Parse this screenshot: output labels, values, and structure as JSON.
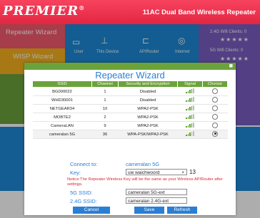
{
  "header": {
    "brand": "PREMIER",
    "brand_mark": "®",
    "model": "11AC Dual Band Wireless Repeater"
  },
  "tiles": {
    "repeater_wizard": "Repeater Wizard",
    "wisp_wizard": "WISP Wizard"
  },
  "topology": {
    "user": "User",
    "device": "This Device",
    "ap": "AP/Router",
    "internet": "Internet"
  },
  "status": {
    "clients_24": "2.4G Wifi Clients: 0",
    "clients_5": "5G Wifi Clients: 0",
    "stars": "★★★★★"
  },
  "modal": {
    "title": "Repeater Wizard",
    "columns": [
      "SSID",
      "Channel",
      "Security and Encryption",
      "Signal",
      "Choose"
    ],
    "rows": [
      {
        "ssid": "BG000022",
        "channel": "1",
        "security": "Disabled",
        "signal": 4,
        "selected": false
      },
      {
        "ssid": "WHD30001",
        "channel": "1",
        "security": "Disabled",
        "signal": 4,
        "selected": false
      },
      {
        "ssid": "NETGEAR34",
        "channel": "10",
        "security": "WPA2-PSK",
        "signal": 4,
        "selected": false
      },
      {
        "ssid": "MOBTE2",
        "channel": "2",
        "security": "WPA2-PSK",
        "signal": 4,
        "selected": false
      },
      {
        "ssid": "CameraLAN",
        "channel": "9",
        "security": "WPA2-PSK",
        "signal": 4,
        "selected": false
      },
      {
        "ssid": "cameralan 5G",
        "channel": "36",
        "security": "WPA-PSK/WPA2-PSK",
        "signal": 3,
        "selected": true
      }
    ],
    "connect_label": "Connect to:",
    "connect_value": "cameralan 5G",
    "key_label": "Key:",
    "key_value": "uw waichwoord",
    "key_clear": "×",
    "key_count": "13",
    "notice": "Notice:The Repeater Wireless Key will be the same as your Wireless AP/Router after settings.",
    "ssid5_label": "5G SSID:",
    "ssid5_value": "cameralan 5G-ext",
    "ssid24_label": "2.4G SSID:",
    "ssid24_value": "cameralan 2.4G-ext",
    "cancel": "Cancel",
    "save": "Save",
    "refresh": "Refresh"
  },
  "colors": {
    "header": "#e83350",
    "green": "#6ba33a",
    "blue": "#2a7fd5",
    "accent_blue": "#1d8ad8",
    "yellow": "#f6b21c"
  }
}
